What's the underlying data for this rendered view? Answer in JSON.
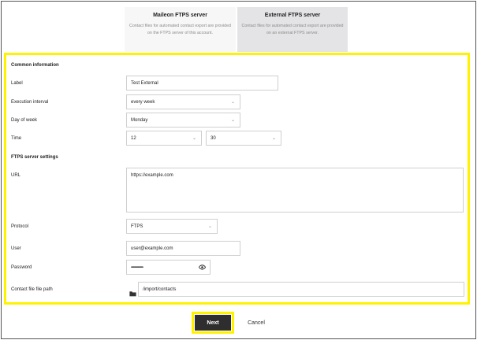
{
  "server_options": {
    "maileon": {
      "title": "Maileon FTPS server",
      "description": "Contact files for automated contact export are provided on the FTPS server of this account."
    },
    "external": {
      "title": "External FTPS server",
      "description": "Contact files for automated contact export are provided on an external FTPS server.",
      "selected": true
    }
  },
  "common": {
    "section_title": "Common information",
    "label_label": "Label",
    "label_value": "Test External",
    "interval_label": "Execution interval",
    "interval_value": "every week",
    "day_label": "Day of week",
    "day_value": "Monday",
    "time_label": "Time",
    "time_hour": "12",
    "time_minute": "30"
  },
  "ftps": {
    "section_title": "FTPS server settings",
    "url_label": "URL",
    "url_value": "https://example.com",
    "protocol_label": "Protocol",
    "protocol_value": "FTPS",
    "user_label": "User",
    "user_value": "user@example.com",
    "password_label": "Password",
    "password_value": "••••••••••••••••••••",
    "path_label": "Contact file file path",
    "path_value": "/import/contacts"
  },
  "actions": {
    "next_label": "Next",
    "cancel_label": "Cancel"
  },
  "icons": {
    "chevron": "chevron-down-icon",
    "eye": "eye-icon",
    "folder": "folder-icon"
  },
  "colors": {
    "highlight": "#fff200",
    "primary_button": "#2e2e2e",
    "selected_card": "#e4e4e6"
  }
}
